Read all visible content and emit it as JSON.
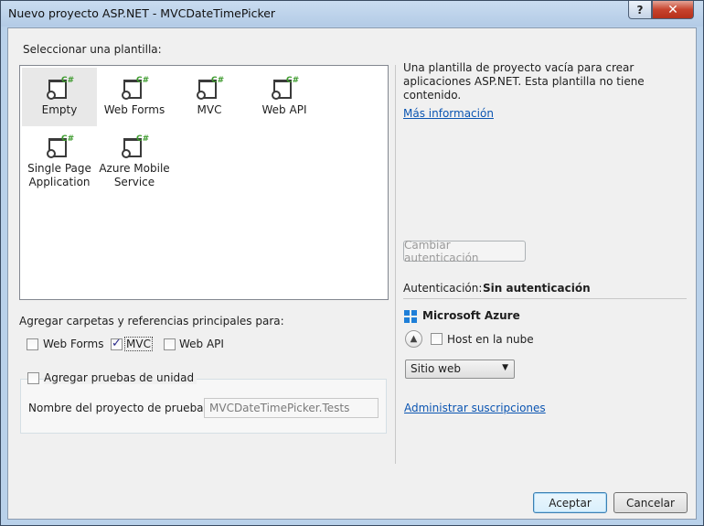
{
  "window": {
    "title": "Nuevo proyecto ASP.NET - MVCDateTimePicker",
    "help_glyph": "?",
    "close_glyph": "✕"
  },
  "templates": {
    "heading": "Seleccionar una plantilla:",
    "items": [
      {
        "label": "Empty",
        "icon": "csharp-web-project-icon",
        "selected": true
      },
      {
        "label": "Web Forms",
        "icon": "csharp-web-project-icon"
      },
      {
        "label": "MVC",
        "icon": "csharp-web-project-icon"
      },
      {
        "label": "Web API",
        "icon": "csharp-web-project-icon"
      },
      {
        "label": "Single Page Application",
        "label_lines": [
          "Single Page",
          "Application"
        ],
        "icon": "csharp-web-project-icon"
      },
      {
        "label": "Azure Mobile Service",
        "label_lines": [
          "Azure Mobile",
          "Service"
        ],
        "icon": "csharp-web-project-icon"
      }
    ],
    "icon_badge": "C#"
  },
  "description": {
    "text": "Una plantilla de proyecto vacía para crear aplicaciones ASP.NET. Esta plantilla no tiene contenido.",
    "more_info_link": "Más información"
  },
  "auth": {
    "change_button": "Cambiar autenticación",
    "label": "Autenticación:",
    "value": "Sin autenticación"
  },
  "folders": {
    "heading": "Agregar carpetas y referencias principales para:",
    "options": [
      {
        "label": "Web Forms",
        "checked": false
      },
      {
        "label": "MVC",
        "checked": true
      },
      {
        "label": "Web API",
        "checked": false
      }
    ]
  },
  "unit_tests": {
    "label": "Agregar pruebas de unidad",
    "checked": false,
    "project_name_label": "Nombre del proyecto de prueba:",
    "project_name_value": "MVCDateTimePicker.Tests"
  },
  "azure": {
    "title": "Microsoft Azure",
    "host_label": "Host en la nube",
    "host_checked": false,
    "collapse_glyph": "▲",
    "site_select": "Sitio web",
    "dropdown_glyph": "▼",
    "manage_link": "Administrar suscripciones"
  },
  "buttons": {
    "ok": "Aceptar",
    "cancel": "Cancelar"
  },
  "colors": {
    "link": "#0b55b2",
    "csharp_badge": "#3c9a2c",
    "azure_logo": "#1e7fd8"
  }
}
